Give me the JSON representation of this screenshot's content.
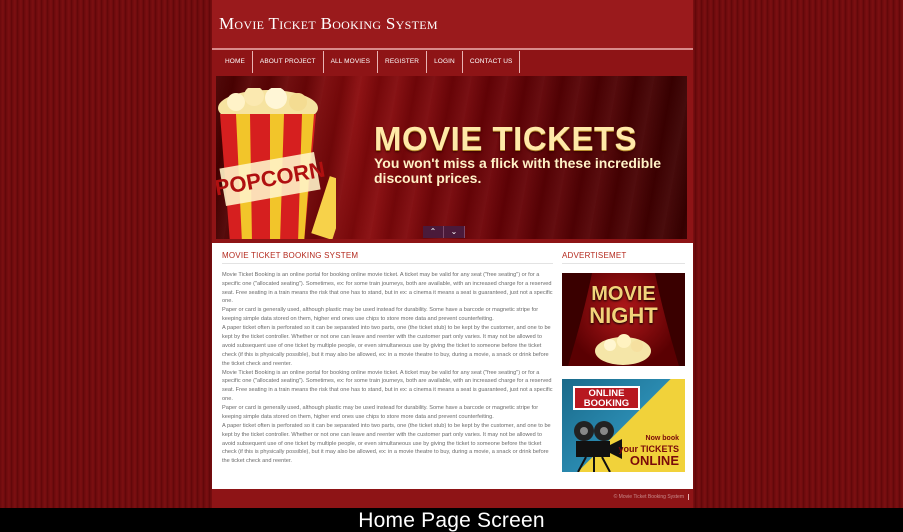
{
  "header": {
    "title": "Movie Ticket Booking System"
  },
  "nav": {
    "items": [
      "HOME",
      "ABOUT PROJECT",
      "ALL MOVIES",
      "REGISTER",
      "LOGIN",
      "CONTACT US"
    ]
  },
  "banner": {
    "popcorn_label": "POPCORN",
    "headline": "MOVIE TICKETS",
    "subline": "You won't miss a flick with these incredible discount prices.",
    "prev_icon": "chevron-up-icon",
    "next_icon": "chevron-down-icon"
  },
  "main": {
    "section_title": "MOVIE TICKET BOOKING SYSTEM",
    "paragraphs": [
      "Movie Ticket Booking is an online portal for booking online movie ticket. A ticket may be valid for any seat (\"free seating\") or for a specific one (\"allocated seating\"). Sometimes, ex: for some train journeys, both are available, with an increased charge for a reserved seat. Free seating in a train means the risk that one has to stand, but in ex: a cinema it means a seat is guaranteed, just not a specific one.",
      "Paper or card is generally used, although plastic may be used instead for durability. Some have a barcode or magnetic stripe for keeping simple data stored on them, higher end ones use chips to store more data and prevent counterfeiting.",
      "A paper ticket often is perforated so it can be separated into two parts, one (the ticket stub) to be kept by the customer, and one to be kept by the ticket controller. Whether or not one can leave and reenter with the customer part only varies. It may not be allowed to avoid subsequent use of one ticket by multiple people, or even simultaneous use by giving the ticket to someone before the ticket check (if this is physically possible), but it may also be allowed, ex: in a movie theatre to buy, during a movie, a snack or drink before the ticket check and reenter.",
      "Movie Ticket Booking is an online portal for booking online movie ticket. A ticket may be valid for any seat (\"free seating\") or for a specific one (\"allocated seating\"). Sometimes, ex: for some train journeys, both are available, with an increased charge for a reserved seat. Free seating in a train means the risk that one has to stand, but in ex: a cinema it means a seat is guaranteed, just not a specific one.",
      "Paper or card is generally used, although plastic may be used instead for durability. Some have a barcode or magnetic stripe for keeping simple data stored on them, higher end ones use chips to store more data and prevent counterfeiting.",
      "A paper ticket often is perforated so it can be separated into two parts, one (the ticket stub) to be kept by the customer, and one to be kept by the ticket controller. Whether or not one can leave and reenter with the customer part only varies. It may not be allowed to avoid subsequent use of one ticket by multiple people, or even simultaneous use by giving the ticket to someone before the ticket check (if this is physically possible), but it may also be allowed, ex: in a movie theatre to buy, during a movie, a snack or drink before the ticket check and reenter."
    ]
  },
  "sidebar": {
    "title": "ADVERTISEMET",
    "ad1": {
      "line1": "MOVIE",
      "line2": "NIGHT"
    },
    "ad2": {
      "badge_line1": "ONLINE",
      "badge_line2": "BOOKING",
      "tagline1": "Now book",
      "tagline2": "your TICKETS",
      "tagline3": "ONLINE"
    }
  },
  "footer": {
    "copyright": "© Movie Ticket Booking System"
  },
  "caption": "Home Page Screen"
}
